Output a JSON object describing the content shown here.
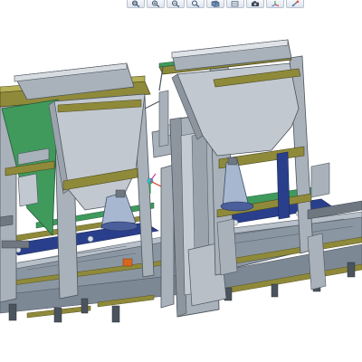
{
  "toolbar": {
    "buttons": [
      {
        "icon": "zoom-fit-icon"
      },
      {
        "icon": "zoom-in-icon"
      },
      {
        "icon": "zoom-out-icon"
      },
      {
        "icon": "zoom-area-icon"
      },
      {
        "icon": "view-orientation-icon"
      },
      {
        "icon": "display-style-icon"
      },
      {
        "icon": "camera-icon"
      },
      {
        "icon": "axis-triad-icon"
      },
      {
        "icon": "appearance-icon"
      }
    ]
  },
  "colors": {
    "frame": "#a9b1ba",
    "frame_dark": "#6f7780",
    "hopper": "#c2c8cf",
    "hopper_green": "#3f9a5c",
    "rail_olive": "#8f8a3a",
    "conveyor_blue": "#2a3f8c",
    "accent_orange": "#d9661e"
  }
}
